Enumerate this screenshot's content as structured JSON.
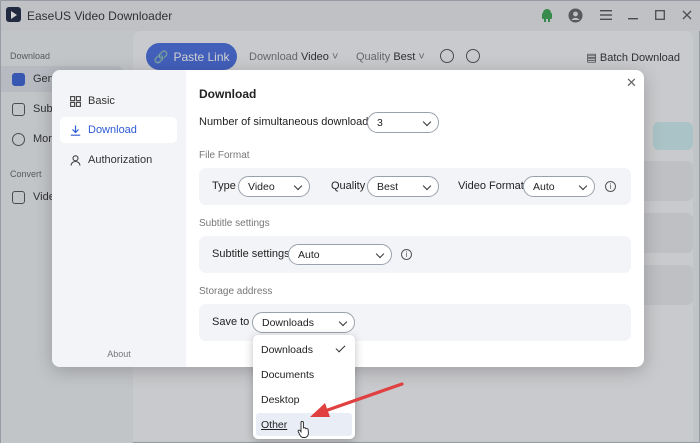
{
  "window": {
    "title": "EaseUS Video Downloader"
  },
  "sidebar": {
    "sections": [
      {
        "label": "Download",
        "items": [
          "General",
          "Subscription",
          "More"
        ]
      },
      {
        "label": "Convert",
        "items": [
          "Video"
        ]
      }
    ],
    "items_visible": [
      "Gene",
      "Subs",
      "More",
      "Vide"
    ]
  },
  "toolbar": {
    "paste_link": "Paste Link",
    "download_label": "Download",
    "download_value": "Video",
    "quality_label": "Quality",
    "quality_value": "Best",
    "batch_download": "Batch Download"
  },
  "dialog": {
    "nav": [
      {
        "label": "Basic",
        "icon": "grid-icon"
      },
      {
        "label": "Download",
        "icon": "download-icon"
      },
      {
        "label": "Authorization",
        "icon": "user-icon"
      }
    ],
    "about": "About",
    "title": "Download",
    "simultaneous": {
      "label": "Number of simultaneous downloads",
      "value": "3"
    },
    "file_format": {
      "title": "File Format",
      "type_label": "Type",
      "type_value": "Video",
      "quality_label": "Quality",
      "quality_value": "Best",
      "vformat_label": "Video Format",
      "vformat_value": "Auto"
    },
    "subtitle": {
      "title": "Subtitle settings",
      "label": "Subtitle settings",
      "value": "Auto"
    },
    "storage": {
      "title": "Storage address",
      "save_label": "Save to",
      "save_value": "Downloads"
    },
    "dropdown": {
      "options": [
        "Downloads",
        "Documents",
        "Desktop",
        "Other"
      ],
      "selected": "Downloads",
      "hovered": "Other"
    }
  },
  "colors": {
    "accent": "#4a6ee0",
    "active_text": "#2e5bd6",
    "arrow": "#e04040"
  }
}
